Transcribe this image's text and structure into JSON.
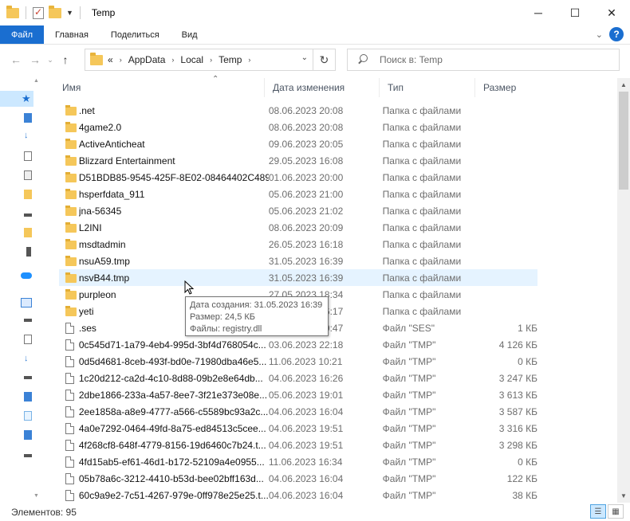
{
  "window": {
    "title": "Temp",
    "controls": {
      "minimize": "─",
      "maximize": "☐",
      "close": "✕"
    }
  },
  "ribbon": {
    "tabs": [
      "Файл",
      "Главная",
      "Поделиться",
      "Вид"
    ],
    "help": "?"
  },
  "address": {
    "overflow": "«",
    "crumbs": [
      "AppData",
      "Local",
      "Temp"
    ],
    "search_placeholder": "Поиск в: Temp"
  },
  "columns": {
    "name": "Имя",
    "date": "Дата изменения",
    "type": "Тип",
    "size": "Размер"
  },
  "files": [
    {
      "name": ".net",
      "date": "08.06.2023 20:08",
      "type": "Папка с файлами",
      "size": "",
      "kind": "folder"
    },
    {
      "name": "4game2.0",
      "date": "08.06.2023 20:08",
      "type": "Папка с файлами",
      "size": "",
      "kind": "folder"
    },
    {
      "name": "ActiveAnticheat",
      "date": "09.06.2023 20:05",
      "type": "Папка с файлами",
      "size": "",
      "kind": "folder"
    },
    {
      "name": "Blizzard Entertainment",
      "date": "29.05.2023 16:08",
      "type": "Папка с файлами",
      "size": "",
      "kind": "folder"
    },
    {
      "name": "D51BDB85-9545-425F-8E02-08464402C489",
      "date": "01.06.2023 20:00",
      "type": "Папка с файлами",
      "size": "",
      "kind": "folder"
    },
    {
      "name": "hsperfdata_911",
      "date": "05.06.2023 21:00",
      "type": "Папка с файлами",
      "size": "",
      "kind": "folder"
    },
    {
      "name": "jna-56345",
      "date": "05.06.2023 21:02",
      "type": "Папка с файлами",
      "size": "",
      "kind": "folder"
    },
    {
      "name": "L2INI",
      "date": "08.06.2023 20:09",
      "type": "Папка с файлами",
      "size": "",
      "kind": "folder"
    },
    {
      "name": "msdtadmin",
      "date": "26.05.2023 16:18",
      "type": "Папка с файлами",
      "size": "",
      "kind": "folder"
    },
    {
      "name": "nsuA59.tmp",
      "date": "31.05.2023 16:39",
      "type": "Папка с файлами",
      "size": "",
      "kind": "folder"
    },
    {
      "name": "nsvB44.tmp",
      "date": "31.05.2023 16:39",
      "type": "Папка с файлами",
      "size": "",
      "kind": "folder",
      "hover": true
    },
    {
      "name": "purpleon",
      "date": "27.05.2023 18:34",
      "type": "Папка с файлами",
      "size": "",
      "kind": "folder"
    },
    {
      "name": "yeti",
      "date": "31.05.2023 16:17",
      "type": "Папка с файлами",
      "size": "",
      "kind": "folder"
    },
    {
      "name": ".ses",
      "date": "09.06.2023 20:47",
      "type": "Файл \"SES\"",
      "size": "1 КБ",
      "kind": "file"
    },
    {
      "name": "0c545d71-1a79-4eb4-995d-3bf4d768054c...",
      "date": "03.06.2023 22:18",
      "type": "Файл \"TMP\"",
      "size": "4 126 КБ",
      "kind": "file"
    },
    {
      "name": "0d5d4681-8ceb-493f-bd0e-71980dba46e5...",
      "date": "11.06.2023 10:21",
      "type": "Файл \"TMP\"",
      "size": "0 КБ",
      "kind": "file"
    },
    {
      "name": "1c20d212-ca2d-4c10-8d88-09b2e8e64db...",
      "date": "04.06.2023 16:26",
      "type": "Файл \"TMP\"",
      "size": "3 247 КБ",
      "kind": "file"
    },
    {
      "name": "2dbe1866-233a-4a57-8ee7-3f21e373e08e...",
      "date": "05.06.2023 19:01",
      "type": "Файл \"TMP\"",
      "size": "3 613 КБ",
      "kind": "file"
    },
    {
      "name": "2ee1858a-a8e9-4777-a566-c5589bc93a2c...",
      "date": "04.06.2023 16:04",
      "type": "Файл \"TMP\"",
      "size": "3 587 КБ",
      "kind": "file"
    },
    {
      "name": "4a0e7292-0464-49fd-8a75-ed84513c5cee...",
      "date": "04.06.2023 19:51",
      "type": "Файл \"TMP\"",
      "size": "3 316 КБ",
      "kind": "file"
    },
    {
      "name": "4f268cf8-648f-4779-8156-19d6460c7b24.t...",
      "date": "04.06.2023 19:51",
      "type": "Файл \"TMP\"",
      "size": "3 298 КБ",
      "kind": "file"
    },
    {
      "name": "4fd15ab5-ef61-46d1-b172-52109a4e0955...",
      "date": "11.06.2023 16:34",
      "type": "Файл \"TMP\"",
      "size": "0 КБ",
      "kind": "file"
    },
    {
      "name": "05b78a6c-3212-4410-b53d-bee02bff163d...",
      "date": "04.06.2023 16:04",
      "type": "Файл \"TMP\"",
      "size": "122 КБ",
      "kind": "file"
    },
    {
      "name": "60c9a9e2-7c51-4267-979e-0ff978e25e25.t...",
      "date": "04.06.2023 16:04",
      "type": "Файл \"TMP\"",
      "size": "38 КБ",
      "kind": "file"
    }
  ],
  "tooltip": {
    "created": "Дата создания: 31.05.2023 16:39",
    "size": "Размер: 24,5 КБ",
    "files": "Файлы: registry.dll"
  },
  "status": {
    "items": "Элементов: 95"
  },
  "colors": {
    "file_tab": "#1a6ed0",
    "hover_row": "#e5f3ff",
    "folder": "#f5c75a"
  }
}
